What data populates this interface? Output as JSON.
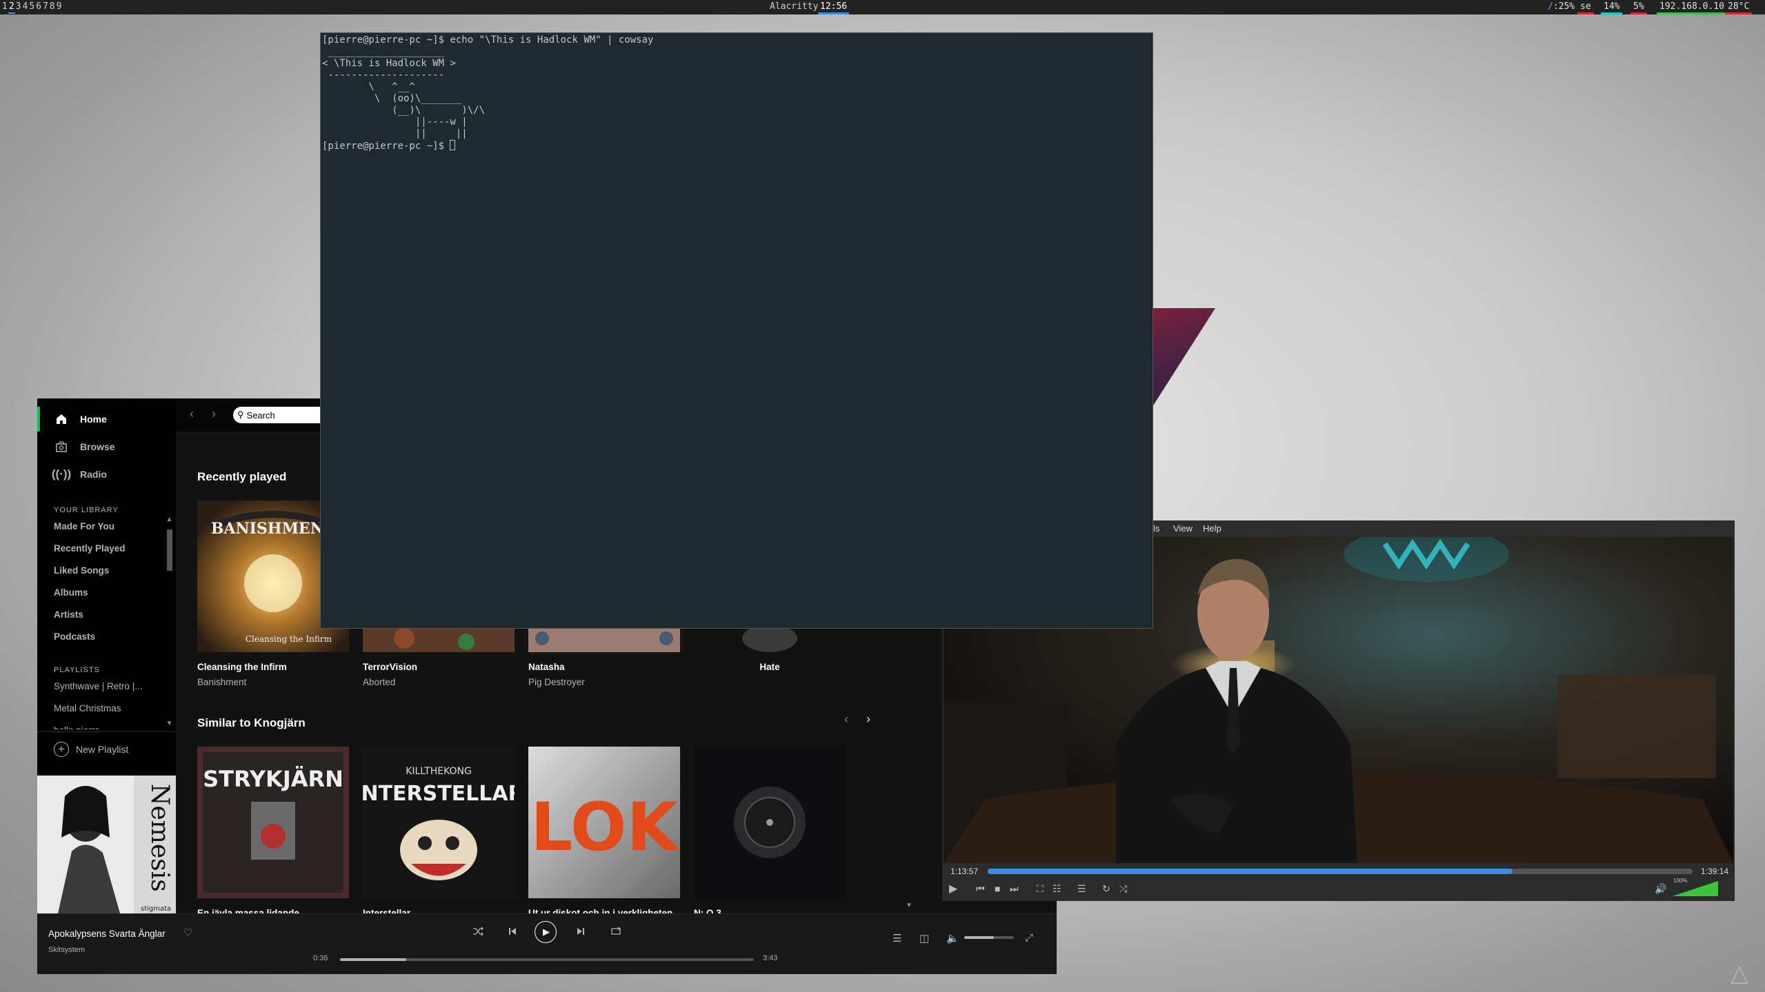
{
  "topbar": {
    "workspaces": [
      "1",
      "2",
      "3",
      "4",
      "5",
      "6",
      "7",
      "8",
      "9"
    ],
    "active_workspace_index": 1,
    "window_title": "Alacritty",
    "clock": "12:56",
    "status": {
      "cpu": "25%",
      "layout": "se",
      "mem": "14%",
      "swap": "5%",
      "ip": "192.168.0.10",
      "temp": "28°C"
    },
    "accent_colors": {
      "cyan": "#19c7c7",
      "red": "#d6283c",
      "green": "#3cbf49",
      "blue": "#3a8ee0"
    }
  },
  "terminal": {
    "prompt": "[pierre@pierre-pc ~]$",
    "command": "echo \"\\This is Hadlock WM\" | cowsay",
    "output_lines": [
      " ____________________",
      "< \\This is Hadlock WM >",
      " --------------------",
      "        \\   ^__^",
      "         \\  (oo)\\_______",
      "            (__)\\       )\\/\\",
      "                ||----w |",
      "                ||     ||"
    ],
    "background": "#1e2a30"
  },
  "spotify": {
    "nav": [
      {
        "label": "Home",
        "icon": "home-icon",
        "active": true
      },
      {
        "label": "Browse",
        "icon": "browse-icon",
        "active": false
      },
      {
        "label": "Radio",
        "icon": "radio-icon",
        "active": false
      }
    ],
    "library_heading": "YOUR LIBRARY",
    "library": [
      "Made For You",
      "Recently Played",
      "Liked Songs",
      "Albums",
      "Artists",
      "Podcasts"
    ],
    "playlists_heading": "PLAYLISTS",
    "playlists": [
      "Synthwave | Retro |...",
      "Metal Christmas",
      "hello pierre"
    ],
    "new_playlist": "New Playlist",
    "search_placeholder": "Search",
    "recently_played_title": "Recently played",
    "recently_played": [
      {
        "title": "Cleansing the Infirm",
        "subtitle": "Banishment"
      },
      {
        "title": "TerrorVision",
        "subtitle": "Aborted"
      },
      {
        "title": "Natasha",
        "subtitle": "Pig Destroyer"
      },
      {
        "title": "Hate",
        "subtitle": ""
      }
    ],
    "similar_title": "Similar to Knogjärn",
    "similar": [
      {
        "title": "En jävla massa lidande",
        "art_text": "STRYKJÄRN"
      },
      {
        "title": "Interstellar",
        "art_text": "INTERSTELLAR",
        "art_sub": "KILLTHEKONG"
      },
      {
        "title": "Ut ur diskot och in i verkligheten",
        "art_text": "LOK"
      },
      {
        "title": "N: O 3",
        "art_text": ""
      }
    ],
    "album_art_text": {
      "cleansing": "Cleansing the Infirm",
      "sidebar_cover": "stigmata"
    },
    "now_playing": {
      "track": "Apokalypsens Svarta Änglar",
      "artist": "Skitsystem",
      "elapsed": "0:36",
      "duration": "3:43",
      "progress": 0.16,
      "volume": 0.6
    },
    "accent": "#1db954"
  },
  "video_player": {
    "menu": [
      "ls",
      "View",
      "Help"
    ],
    "elapsed": "1:13:57",
    "duration": "1:39:14",
    "progress": 0.745,
    "volume_label": "100%",
    "volume": 1.0
  }
}
